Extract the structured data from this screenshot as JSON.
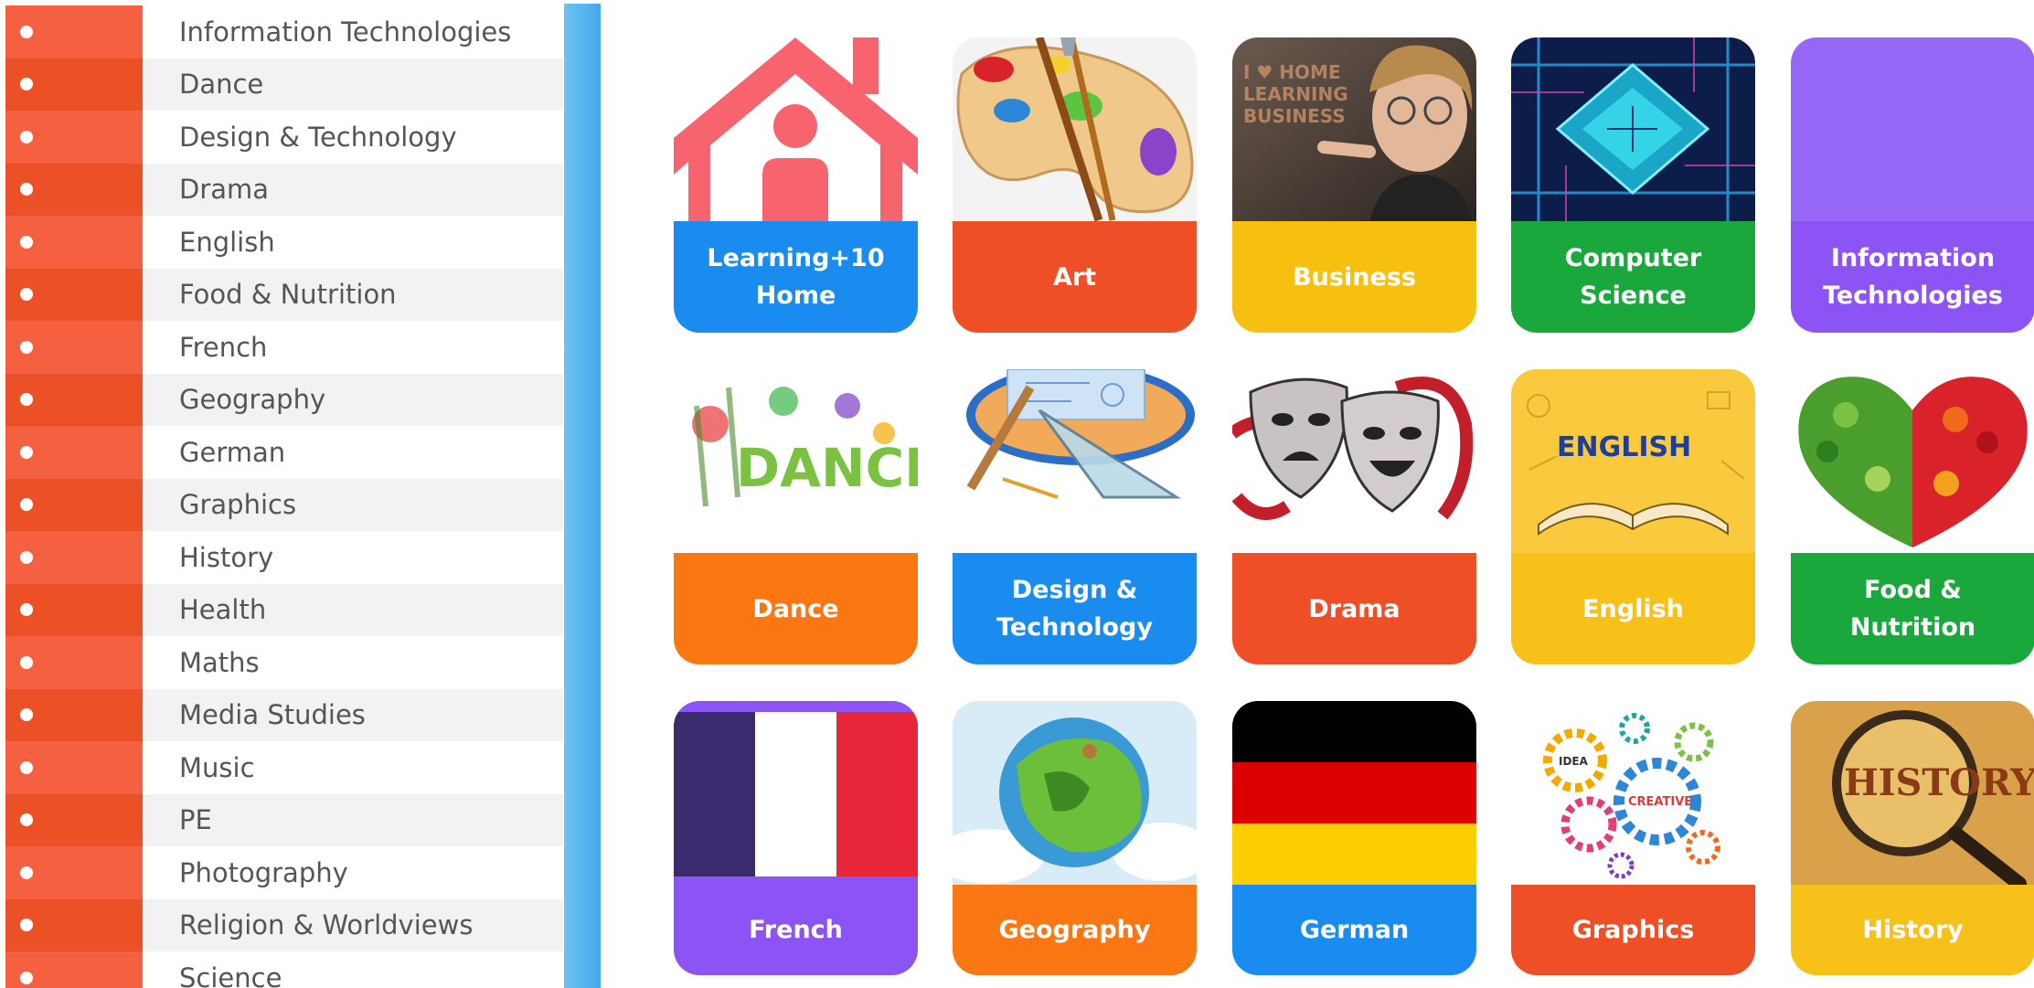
{
  "sidebar": {
    "items": [
      {
        "label": "Information Technologies"
      },
      {
        "label": "Dance"
      },
      {
        "label": "Design & Technology"
      },
      {
        "label": "Drama"
      },
      {
        "label": "English"
      },
      {
        "label": "Food & Nutrition"
      },
      {
        "label": "French"
      },
      {
        "label": "Geography"
      },
      {
        "label": "German"
      },
      {
        "label": "Graphics"
      },
      {
        "label": "History"
      },
      {
        "label": "Health"
      },
      {
        "label": "Maths"
      },
      {
        "label": "Media Studies"
      },
      {
        "label": "Music"
      },
      {
        "label": "PE"
      },
      {
        "label": "Photography"
      },
      {
        "label": "Religion & Worldviews"
      },
      {
        "label": "Science"
      }
    ]
  },
  "tiles": [
    {
      "label": "Learning+10\nHome",
      "color": "#1a8cf0",
      "icon": "house-person-icon"
    },
    {
      "label": "Art",
      "color": "#ef4f27",
      "icon": "paint-palette-icon"
    },
    {
      "label": "Business",
      "color": "#f7bf10",
      "icon": "business-photo-icon"
    },
    {
      "label": "Computer\nScience",
      "color": "#1aa83c",
      "icon": "circuit-board-icon"
    },
    {
      "label": "Information\nTechnologies",
      "color": "#8d54f5",
      "icon": "purple-blank-icon"
    },
    {
      "label": "Dance",
      "color": "#fb7713",
      "icon": "dance-splash-icon"
    },
    {
      "label": "Design &\nTechnology",
      "color": "#1a8cf0",
      "icon": "drafting-tools-icon"
    },
    {
      "label": "Drama",
      "color": "#ef4f27",
      "icon": "theatre-masks-icon"
    },
    {
      "label": "English",
      "color": "#f8c11a",
      "icon": "open-book-icon"
    },
    {
      "label": "Food &\nNutrition",
      "color": "#1aa83c",
      "icon": "fruit-heart-icon"
    },
    {
      "label": "French",
      "color": "#8d54f5",
      "icon": "french-flag-icon"
    },
    {
      "label": "Geography",
      "color": "#fb7713",
      "icon": "globe-icon"
    },
    {
      "label": "German",
      "color": "#1a8cf0",
      "icon": "german-flag-icon"
    },
    {
      "label": "Graphics",
      "color": "#ef4f27",
      "icon": "gears-icon"
    },
    {
      "label": "History",
      "color": "#f8c11a",
      "icon": "magnifier-history-icon"
    }
  ],
  "art": {
    "business_sign": "I ♥ HOME\nLEARNING\nBUSINESS",
    "dance_word": "DANCE",
    "english_word": "ENGLISH",
    "gears_idea": "IDEA",
    "gears_creative": "CREATIVE",
    "history_word": "HISTORY"
  }
}
